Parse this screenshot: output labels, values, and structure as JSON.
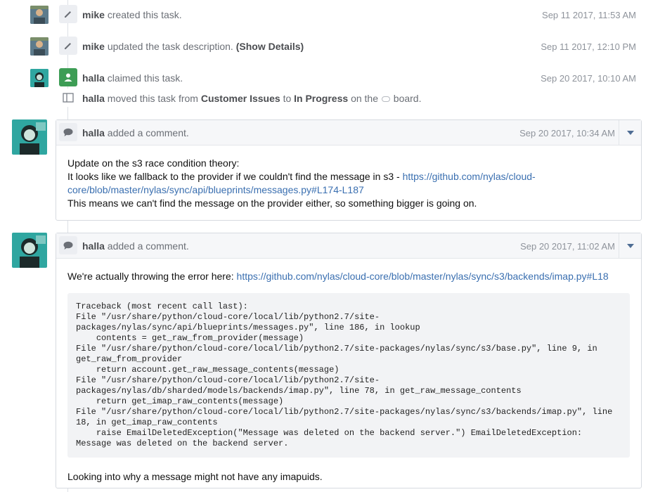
{
  "events": [
    {
      "user": "mike",
      "action": "created this task.",
      "time": "Sep 11 2017, 11:53 AM",
      "icon": "pencil-icon"
    },
    {
      "user": "mike",
      "action": "updated the task description.",
      "extra": "(Show Details)",
      "time": "Sep 11 2017, 12:10 PM",
      "icon": "pencil-icon"
    },
    {
      "user": "halla",
      "action": "claimed this task.",
      "time": "Sep 20 2017, 10:10 AM",
      "icon": "user-icon"
    },
    {
      "user": "halla",
      "moved_pre": "moved this task from",
      "from": "Customer Issues",
      "to_word": "to",
      "to": "In Progress",
      "on_the": "on the",
      "board": "board.",
      "icon": "board-icon"
    }
  ],
  "comments": [
    {
      "user": "halla",
      "action": "added a comment.",
      "time": "Sep 20 2017, 10:34 AM",
      "line1": "Update on the s3 race condition theory:",
      "line2_pre": "It looks like we fallback to the provider if we couldn't find the message in s3 - ",
      "line2_link": "https://github.com/nylas/cloud-core/blob/master/nylas/sync/api/blueprints/messages.py#L174-L187",
      "line3": "This means we can't find the message on the provider either, so something bigger is going on."
    },
    {
      "user": "halla",
      "action": "added a comment.",
      "time": "Sep 20 2017, 11:02 AM",
      "line1_pre": "We're actually throwing the error here: ",
      "line1_link": "https://github.com/nylas/cloud-core/blob/master/nylas/sync/s3/backends/imap.py#L18",
      "traceback": "Traceback (most recent call last):\nFile \"/usr/share/python/cloud-core/local/lib/python2.7/site-packages/nylas/sync/api/blueprints/messages.py\", line 186, in lookup\n    contents = get_raw_from_provider(message)\nFile \"/usr/share/python/cloud-core/local/lib/python2.7/site-packages/nylas/sync/s3/base.py\", line 9, in get_raw_from_provider\n    return account.get_raw_message_contents(message)\nFile \"/usr/share/python/cloud-core/local/lib/python2.7/site-packages/nylas/db/sharded/models/backends/imap.py\", line 78, in get_raw_message_contents\n    return get_imap_raw_contents(message)\nFile \"/usr/share/python/cloud-core/local/lib/python2.7/site-packages/nylas/sync/s3/backends/imap.py\", line 18, in get_imap_raw_contents\n    raise EmailDeletedException(\"Message was deleted on the backend server.\") EmailDeletedException: Message was deleted on the backend server.",
      "footer": "Looking into why a message might not have any imapuids."
    }
  ],
  "colors": {
    "link": "#3a6fb0",
    "claim_badge": "#3d9d55",
    "mike_avatar": "#5d7b8c",
    "halla_avatar": "#2fa6a0"
  }
}
